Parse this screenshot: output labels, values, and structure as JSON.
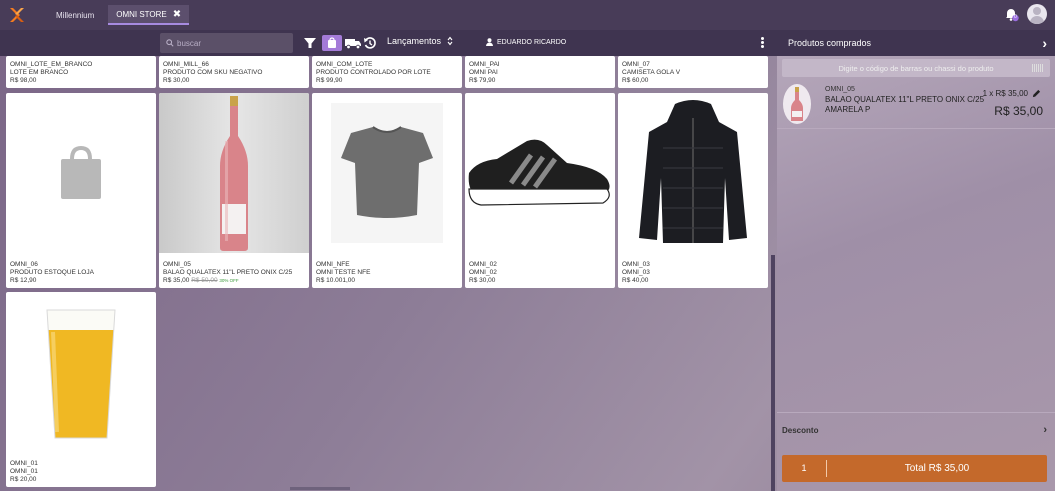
{
  "topbar": {
    "tabs": [
      {
        "label": "Millennium",
        "active": false
      },
      {
        "label": "OMNI STORE",
        "active": true,
        "close": "✖"
      }
    ],
    "notification_count": "0"
  },
  "toolbar": {
    "search_placeholder": "buscar",
    "lancamentos_label": "Lançamentos",
    "user_name": "EDUARDO RICARDO",
    "accent": "#a47bd8"
  },
  "products": [
    {
      "code": "OMNI_LOTE_EM_BRANCO",
      "name": "LOTE EM BRANCO",
      "price": "R$ 98,00"
    },
    {
      "code": "OMNI_MILL_66",
      "name": "PRODUTO COM SKU NEGATIVO",
      "price": "R$ 30,00"
    },
    {
      "code": "OMNI_COM_LOTE",
      "name": "PRODUTO CONTROLADO POR LOTE",
      "price": "R$ 99,90"
    },
    {
      "code": "OMNI_PAI",
      "name": "OMNI PAI",
      "price": "R$ 79,90"
    },
    {
      "code": "OMNI_07",
      "name": "CAMISETA GOLA V",
      "price": "R$ 60,00"
    },
    {
      "code": "OMNI_06",
      "name": "PRODUTO ESTOQUE LOJA",
      "price": "R$ 12,90",
      "image": "shopping-bag-placeholder-icon"
    },
    {
      "code": "OMNI_05",
      "name": "BALAO QUALATEX 11\"L PRETO ONIX C/25",
      "price": "R$ 35,00",
      "old_price": "R$ 50,00",
      "discount": "30% OFF",
      "image": "wine-bottle-image"
    },
    {
      "code": "OMNI_NFE",
      "name": "OMNI TESTE NFE",
      "price": "R$ 10.001,00",
      "image": "gray-tshirt-image"
    },
    {
      "code": "OMNI_02",
      "name": "OMNI_02",
      "price": "R$ 30,00",
      "image": "sneaker-image"
    },
    {
      "code": "OMNI_03",
      "name": "OMNI_03",
      "price": "R$ 40,00",
      "image": "black-jacket-image"
    },
    {
      "code": "OMNI_01",
      "name": "OMNI_01",
      "price": "R$ 20,00",
      "image": "beer-glass-image"
    }
  ],
  "cart": {
    "title": "Produtos comprados",
    "barcode_placeholder": "Digite o código de barras ou chassi do produto",
    "item": {
      "code": "OMNI_05",
      "name": "BALAO QUALATEX 11\"L PRETO ONIX C/25 AMARELA P",
      "qty_price": "1 x R$ 35,00",
      "total": "R$ 35,00"
    },
    "discount_label": "Desconto",
    "quantity": "1",
    "total_label": "Total R$ 35,00",
    "total_color": "#c4692b"
  }
}
